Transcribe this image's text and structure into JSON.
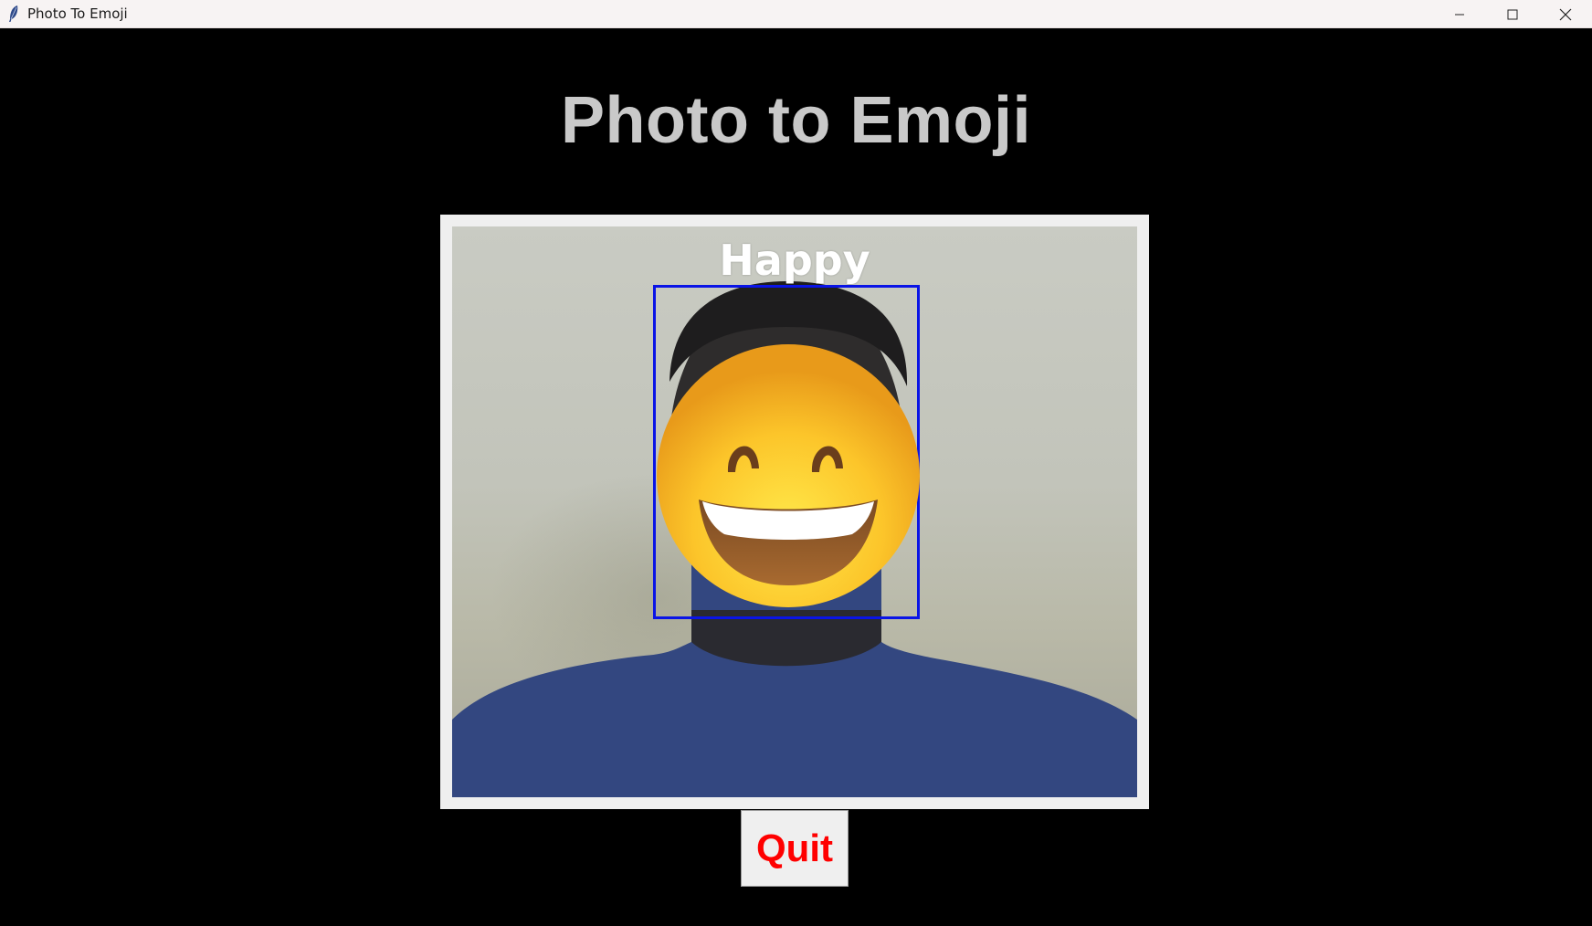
{
  "window": {
    "title": "Photo To Emoji",
    "app_icon": "feather-icon",
    "controls": [
      "minimize-icon",
      "maximize-icon",
      "close-icon"
    ]
  },
  "main": {
    "heading": "Photo to Emoji",
    "heading_color": "#c9c9c9",
    "background_color": "#000000"
  },
  "camera": {
    "emotion_label": "Happy",
    "face_box_color": "#0a14e6",
    "overlay_emoji": "grinning-face-with-smiling-eyes"
  },
  "actions": {
    "quit_label": "Quit",
    "quit_color": "#ff0000"
  }
}
